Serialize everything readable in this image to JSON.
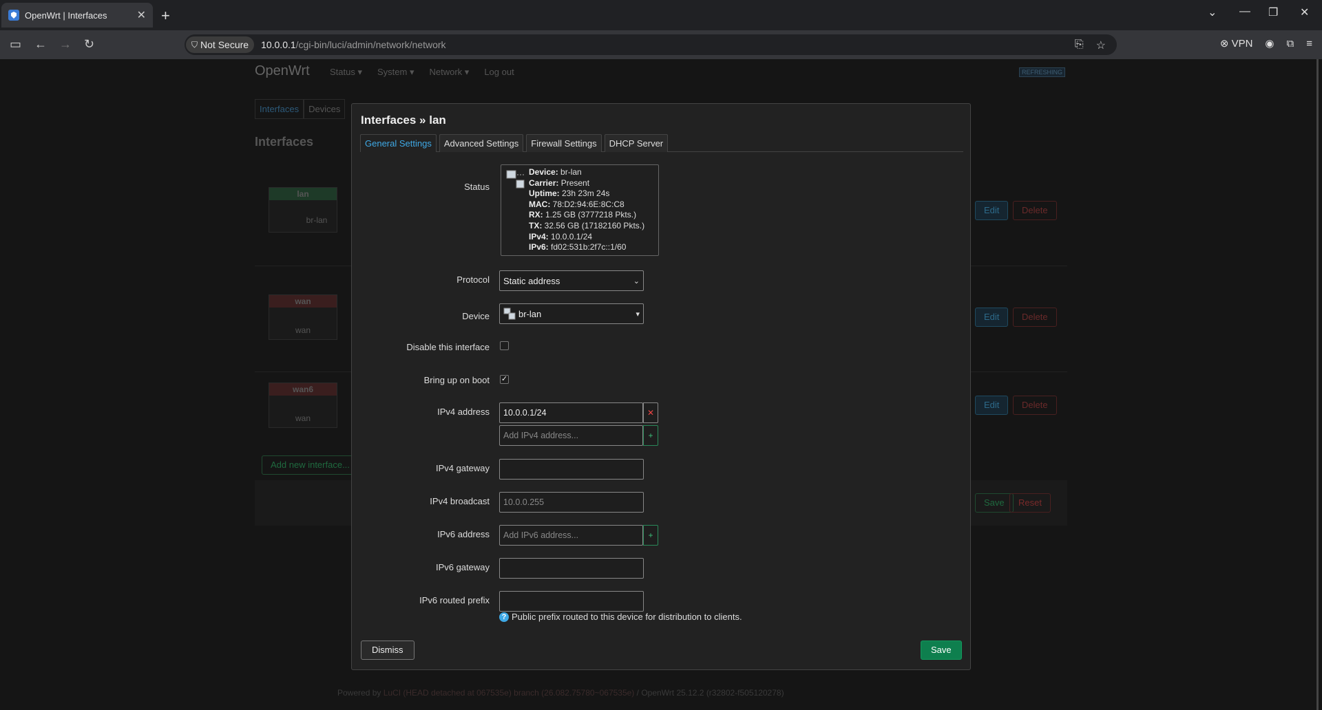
{
  "browser": {
    "tab_title": "OpenWrt | Interfaces",
    "not_secure_label": "Not Secure",
    "url_host": "10.0.0.1",
    "url_path": "/cgi-bin/luci/admin/network/network",
    "vpn_label": "VPN"
  },
  "background": {
    "brand": "OpenWrt",
    "menu": [
      "Status ▾",
      "System ▾",
      "Network ▾",
      "Log out"
    ],
    "refreshing": "REFRESHING",
    "tabs": [
      "Interfaces",
      "Devices"
    ],
    "heading": "Interfaces",
    "interfaces": [
      {
        "name": "lan",
        "device": "br-lan"
      },
      {
        "name": "wan",
        "device": "wan"
      },
      {
        "name": "wan6",
        "device": "wan"
      }
    ],
    "edit_label": "Edit",
    "delete_label": "Delete",
    "add_interface_label": "Add new interface...",
    "save_label": "Save",
    "reset_label": "Reset",
    "footer_prefix": "Powered by ",
    "footer_link": "LuCI (HEAD detached at 067535e) branch (26.082.75780~067535e)",
    "footer_suffix": " / OpenWrt 25.12.2 (r32802-f505120278)",
    "colors": {
      "edit": "#1f5a7a",
      "delete": "#7a2a2a",
      "save": "#1f6a3f"
    }
  },
  "modal": {
    "title": "Interfaces » lan",
    "tabs": [
      "General Settings",
      "Advanced Settings",
      "Firewall Settings",
      "DHCP Server"
    ],
    "active_tab": "General Settings",
    "status": {
      "label": "Status",
      "lines": [
        {
          "k": "Device:",
          "v": " br-lan"
        },
        {
          "k": "Carrier:",
          "v": " Present"
        },
        {
          "k": "Uptime:",
          "v": " 23h 23m 24s"
        },
        {
          "k": "MAC:",
          "v": " 78:D2:94:6E:8C:C8"
        },
        {
          "k": "RX:",
          "v": " 1.25 GB (3777218 Pkts.)"
        },
        {
          "k": "TX:",
          "v": " 32.56 GB (17182160 Pkts.)"
        },
        {
          "k": "IPv4:",
          "v": " 10.0.0.1/24"
        },
        {
          "k": "IPv6:",
          "v": " fd02:531b:2f7c::1/60"
        }
      ]
    },
    "protocol": {
      "label": "Protocol",
      "value": "Static address"
    },
    "device": {
      "label": "Device",
      "value": "br-lan"
    },
    "disable": {
      "label": "Disable this interface",
      "checked": false
    },
    "bootup": {
      "label": "Bring up on boot",
      "checked": true
    },
    "ipv4_address": {
      "label": "IPv4 address",
      "value": "10.0.0.1/24",
      "add_placeholder": "Add IPv4 address..."
    },
    "ipv4_gateway": {
      "label": "IPv4 gateway",
      "value": ""
    },
    "ipv4_broadcast": {
      "label": "IPv4 broadcast",
      "placeholder": "10.0.0.255"
    },
    "ipv6_address": {
      "label": "IPv6 address",
      "add_placeholder": "Add IPv6 address..."
    },
    "ipv6_gateway": {
      "label": "IPv6 gateway",
      "value": ""
    },
    "ipv6_prefix": {
      "label": "IPv6 routed prefix",
      "value": "",
      "hint": "Public prefix routed to this device for distribution to clients."
    },
    "dismiss_label": "Dismiss",
    "save_label": "Save"
  }
}
